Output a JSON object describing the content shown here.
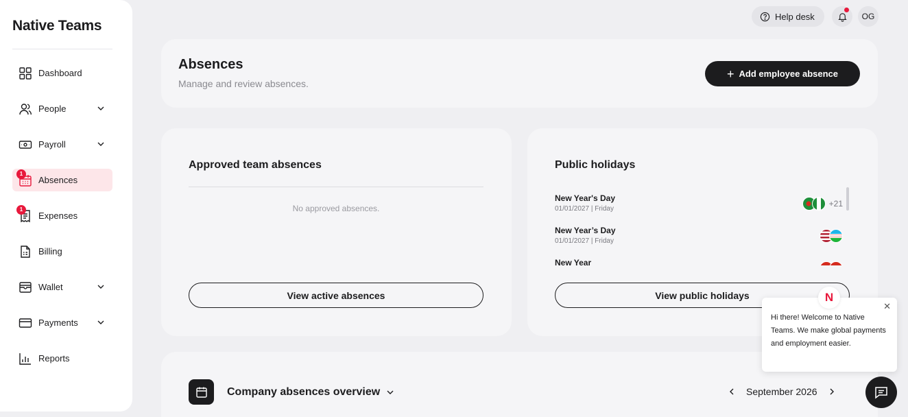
{
  "app": {
    "logo": "Native Teams"
  },
  "topbar": {
    "help_label": "Help desk",
    "avatar_initials": "OG",
    "has_notification": true
  },
  "sidebar": {
    "items": [
      {
        "label": "Dashboard",
        "icon": "grid-icon"
      },
      {
        "label": "People",
        "icon": "people-icon",
        "expandable": true
      },
      {
        "label": "Payroll",
        "icon": "payroll-icon",
        "expandable": true
      },
      {
        "label": "Absences",
        "icon": "calendar-icon",
        "active": true,
        "badge": "1"
      },
      {
        "label": "Expenses",
        "icon": "receipt-icon",
        "badge": "1"
      },
      {
        "label": "Billing",
        "icon": "document-icon"
      },
      {
        "label": "Wallet",
        "icon": "wallet-icon",
        "expandable": true
      },
      {
        "label": "Payments",
        "icon": "card-icon",
        "expandable": true
      },
      {
        "label": "Reports",
        "icon": "bar-chart-icon"
      }
    ]
  },
  "header": {
    "title": "Absences",
    "subtitle": "Manage and review absences.",
    "add_button": "Add employee absence"
  },
  "approved": {
    "title": "Approved team absences",
    "empty": "No approved absences.",
    "button": "View active absences"
  },
  "holidays": {
    "title": "Public holidays",
    "items": [
      {
        "name": "New Year's Day",
        "date": "01/01/2027 | Friday",
        "more": "+21"
      },
      {
        "name": "New Year’s Day",
        "date": "01/01/2027 | Friday",
        "more": ""
      },
      {
        "name": "New Year",
        "date": "",
        "more": ""
      }
    ],
    "button": "View public holidays"
  },
  "overview": {
    "title": "Company absences overview",
    "month": "September 2026"
  },
  "chat": {
    "message": "Hi there! Welcome to Native Teams. We make global payments and employment easier.",
    "logo": "N"
  },
  "colors": {
    "accent": "#e8193c",
    "dark": "#1c1c1e",
    "active_bg": "#fde6e9"
  }
}
